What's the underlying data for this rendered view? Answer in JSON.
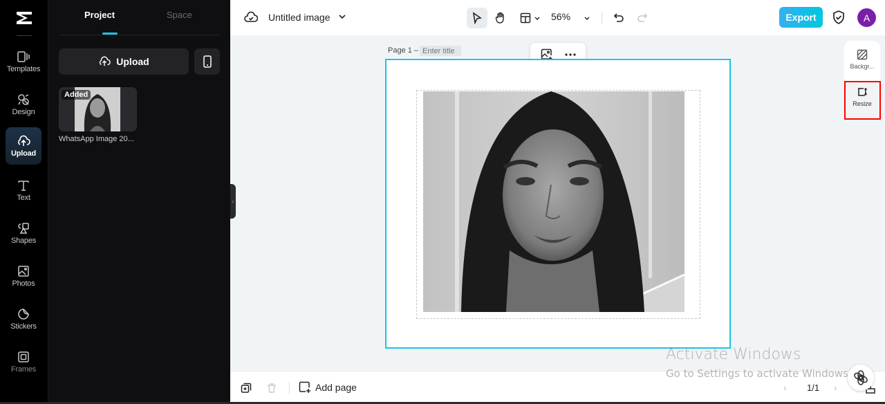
{
  "sidebar": {
    "items": [
      {
        "label": "Templates",
        "icon": "templates-icon"
      },
      {
        "label": "Design",
        "icon": "design-icon"
      },
      {
        "label": "Upload",
        "icon": "upload-cloud-icon",
        "active": true
      },
      {
        "label": "Text",
        "icon": "text-icon"
      },
      {
        "label": "Shapes",
        "icon": "shapes-icon"
      },
      {
        "label": "Photos",
        "icon": "photos-icon"
      },
      {
        "label": "Stickers",
        "icon": "stickers-icon"
      },
      {
        "label": "Frames",
        "icon": "frames-icon"
      }
    ]
  },
  "panel": {
    "tabs": [
      {
        "label": "Project",
        "active": true
      },
      {
        "label": "Space",
        "active": false
      }
    ],
    "upload_label": "Upload",
    "assets": [
      {
        "badge": "Added",
        "name": "WhatsApp Image 20..."
      }
    ]
  },
  "topbar": {
    "title": "Untitled image",
    "zoom": "56%",
    "export_label": "Export",
    "avatar_initial": "A"
  },
  "canvas": {
    "page_label": "Page 1 –",
    "title_placeholder": "Enter title"
  },
  "right_panel": {
    "items": [
      {
        "label": "Backgr...",
        "icon": "background-icon"
      },
      {
        "label": "Resize",
        "icon": "resize-icon",
        "highlighted": true
      }
    ]
  },
  "bottombar": {
    "add_page_label": "Add page",
    "page_indicator": "1/1"
  },
  "watermark": {
    "line1": "Activate Windows",
    "line2": "Go to Settings to activate Windows."
  },
  "colors": {
    "accent": "#1ec3e6",
    "export_gradient_start": "#33b0ef",
    "export_gradient_end": "#00c8de",
    "avatar": "#7a1fa8",
    "highlight_box": "#ff0000"
  }
}
